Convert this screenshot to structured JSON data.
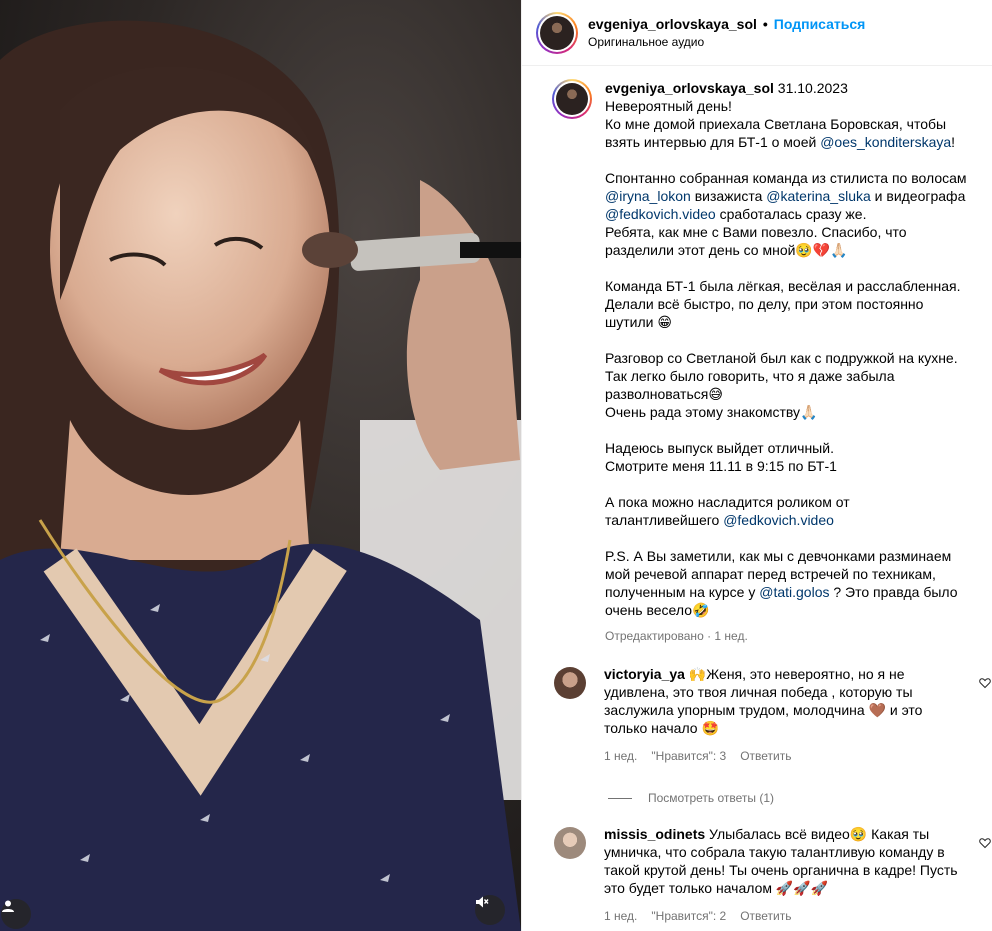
{
  "header": {
    "username": "evgeniya_orlovskaya_sol",
    "separator": "•",
    "follow_label": "Подписаться",
    "audio": "Оригинальное аудио"
  },
  "caption": {
    "username": "evgeniya_orlovskaya_sol",
    "date": "31.10.2023",
    "l1": "Невероятный день!",
    "l2a": "Ко мне домой приехала Светлана Боровская, чтобы взять интервью для БТ-1 о моей ",
    "l2m": "@oes_konditerskaya",
    "l2b": "!",
    "p2a": "Спонтанно собранная команда из стилиста по волосам ",
    "p2m1": "@iryna_lokon",
    "p2b": " визажиста ",
    "p2m2": "@katerina_sluka",
    "p2c": " и видеографа ",
    "p2m3": "@fedkovich.video",
    "p2d": " сработалась сразу же.",
    "p2e": "Ребята, как мне с Вами повезло. Спасибо, что разделили этот день со мной🥹💔🙏🏻",
    "p3": "Команда БТ-1 была лёгкая, весёлая и расслабленная. Делали всё быстро, по делу, при этом постоянно шутили 😁",
    "p4a": "Разговор со Светланой был как с подружкой на кухне. Так легко было говорить, что я даже забыла разволноваться😅",
    "p4b": "Очень рада этому знакомству🙏🏻",
    "p5a": "Надеюсь выпуск выйдет отличный.",
    "p5b": "Смотрите меня 11.11 в 9:15 по БТ-1",
    "p6a": "А пока можно насладится роликом от талантливейшего ",
    "p6m": "@fedkovich.video",
    "p7a": "P.S. А Вы заметили, как мы с девчонками разминаем мой речевой аппарат перед встречей по техникам, полученным на курсе у ",
    "p7m": "@tati.golos",
    "p7b": " ? Это правда было очень весело🤣",
    "meta": "Отредактировано · 1 нед."
  },
  "comments": [
    {
      "username": "victoryia_ya",
      "text": " 🙌Женя, это невероятно, но я не удивлена, это твоя личная победа , которую ты заслужила упорным трудом, молодчина 🤎 и это только начало 🤩",
      "time": "1 нед.",
      "likes": "\"Нравится\": 3",
      "reply": "Ответить",
      "avatar_color": "#7a5a48"
    },
    {
      "username": "missis_odinets",
      "text": " Улыбалась всё видео🥹 Какая ты умничка, что собрала такую талантливую команду в такой крутой день! Ты очень органична в кадре! Пусть это будет только началом 🚀🚀🚀",
      "time": "1 нед.",
      "likes": "\"Нравится\": 2",
      "reply": "Ответить",
      "avatar_color": "#b8a89c"
    }
  ],
  "view_replies": "Посмотреть ответы (1)",
  "colors": {
    "accent": "#0095f6",
    "mention": "#00376b",
    "muted": "#737373"
  },
  "icons": {
    "user_tag": "user-icon",
    "mute": "sound-off-icon",
    "like": "heart-icon"
  }
}
